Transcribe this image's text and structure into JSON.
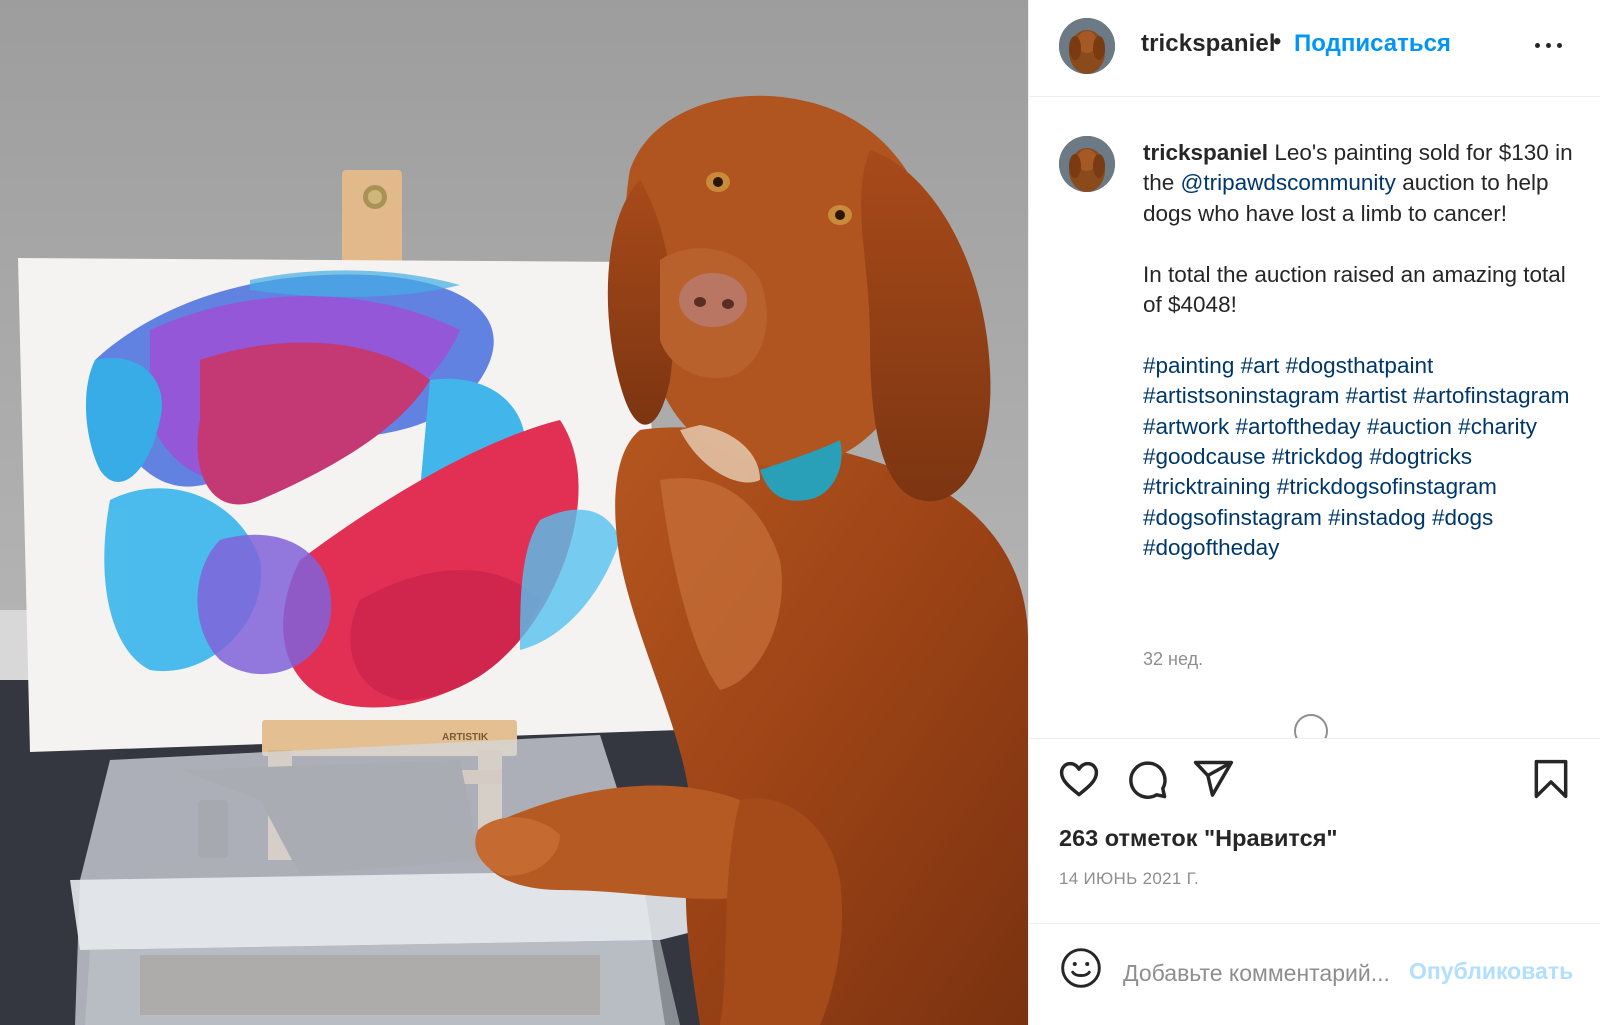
{
  "post": {
    "username": "trickspaniel",
    "separator": "•",
    "follow_label": "Подписаться",
    "more_icon": "more-horizontal-icon"
  },
  "caption": {
    "username": "trickspaniel",
    "text_part1": "Leo's painting sold for $130 in the ",
    "mention": "@tripawdscommunity",
    "text_part2": " auction to help dogs who have lost a limb to cancer!",
    "paragraph2": "In total the auction raised an amazing total of $4048!",
    "hashtags": "#painting #art #dogsthatpaint #artistsoninstagram #artist #artofinstagram #artwork #artoftheday #auction #charity #goodcause #trickdog #dogtricks #tricktraining #trickdogsofinstagram #dogsofinstagram #instadog #dogs #dogoftheday",
    "time_ago": "32 нед."
  },
  "photo": {
    "easel_brand": "ARTISTIK"
  },
  "actions": {
    "icons": [
      "heart-icon",
      "comment-icon",
      "share-icon",
      "bookmark-icon"
    ],
    "likes_text": "263 отметок \"Нравится\"",
    "date": "14 ИЮНЬ 2021 Г."
  },
  "comment_bar": {
    "emoji_icon": "smiley-icon",
    "placeholder": "Добавьте комментарий...",
    "publish_label": "Опубликовать"
  },
  "colors": {
    "link_blue": "#0095f6",
    "publish_disabled": "#b2dffc",
    "hashtag_blue": "#00376b",
    "secondary_text": "#8e8e8e",
    "border": "#efefef"
  }
}
